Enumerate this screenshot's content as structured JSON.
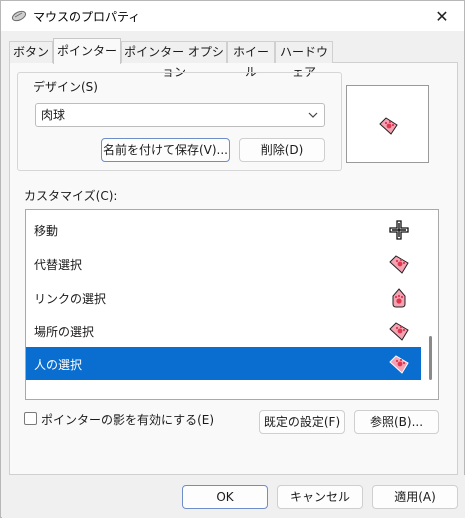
{
  "window": {
    "title": "マウスのプロパティ",
    "close_glyph": "✕"
  },
  "tabs": [
    {
      "label": "ボタン",
      "active": false
    },
    {
      "label": "ポインター",
      "active": true
    },
    {
      "label": "ポインター オプション",
      "active": false
    },
    {
      "label": "ホイール",
      "active": false
    },
    {
      "label": "ハードウェア",
      "active": false
    }
  ],
  "design": {
    "group_label": "デザイン(S)",
    "scheme_value": "肉球",
    "save_as_label": "名前を付けて保存(V)...",
    "delete_label": "削除(D)"
  },
  "customize": {
    "label": "カスタマイズ(C):",
    "items": [
      {
        "label": "移動",
        "icon": "move-cross-icon",
        "selected": false
      },
      {
        "label": "代替選択",
        "icon": "paw-tag-icon",
        "selected": false
      },
      {
        "label": "リンクの選択",
        "icon": "paw-drop-icon",
        "selected": false
      },
      {
        "label": "場所の選択",
        "icon": "paw-tag-icon",
        "selected": false
      },
      {
        "label": "人の選択",
        "icon": "paw-tag-icon",
        "selected": true
      }
    ]
  },
  "options": {
    "shadow_checkbox_label": "ポインターの影を有効にする(E)",
    "shadow_checked": false,
    "default_button": "既定の設定(F)",
    "browse_button": "参照(B)..."
  },
  "footer": {
    "ok": "OK",
    "cancel": "キャンセル",
    "apply": "適用(A)"
  },
  "colors": {
    "selection": "#0a6ed1",
    "paw_pink": "#f4a3b4",
    "paw_red": "#e0374f"
  }
}
